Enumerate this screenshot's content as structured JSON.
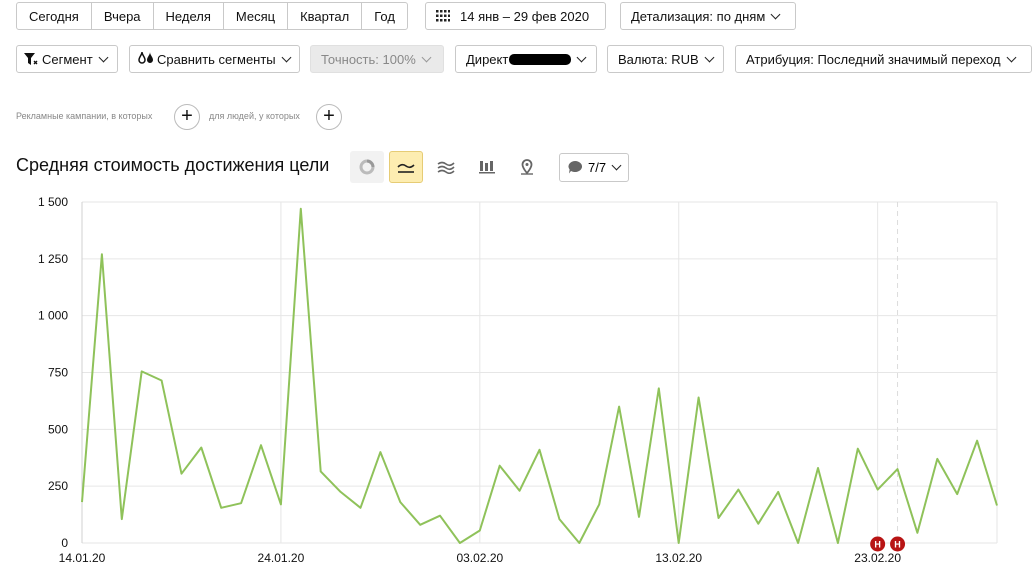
{
  "toolbar": {
    "periods": [
      "Сегодня",
      "Вчера",
      "Неделя",
      "Месяц",
      "Квартал",
      "Год"
    ],
    "date_range": "14 янв – 29 фев 2020",
    "detail": "Детализация: по дням"
  },
  "filters": {
    "segment": "Сегмент",
    "compare": "Сравнить сегменты",
    "accuracy": "Точность:  100%",
    "direct": "Директ",
    "currency": "Валюта: RUB",
    "attribution": "Атрибуция: Последний значимый переход"
  },
  "conditions": {
    "campaigns_hint": "Рекламные кампании, в которых",
    "people_hint": "для людей, у которых"
  },
  "report": {
    "title": "Средняя стоимость достижения цели",
    "annotations_count": "7/7",
    "marker_label": "Н"
  },
  "colors": {
    "line": "#8fc25a",
    "active_view": "#fdedb1",
    "marker": "#b81414",
    "holiday_label": "#b81414"
  },
  "chart_data": {
    "type": "line",
    "title": "Средняя стоимость достижения цели",
    "x_ticks": [
      "14.01.20",
      "24.01.20",
      "03.02.20",
      "13.02.20",
      "23.02.20"
    ],
    "y_ticks": [
      "0",
      "250",
      "500",
      "750",
      "1 000",
      "1 250",
      "1 500"
    ],
    "ylim": [
      0,
      1500
    ],
    "x_start": "2020-01-14",
    "x_end": "2020-02-29",
    "grid": true,
    "holiday_tick": "23.02.20",
    "marker_dates": [
      "2020-02-23",
      "2020-02-24"
    ],
    "series": [
      {
        "values": [
          180,
          1270,
          105,
          755,
          715,
          305,
          420,
          155,
          175,
          430,
          170,
          1470,
          315,
          225,
          155,
          400,
          180,
          80,
          120,
          0,
          55,
          340,
          230,
          410,
          105,
          0,
          170,
          600,
          115,
          680,
          0,
          640,
          110,
          235,
          85,
          225,
          0,
          330,
          0,
          415,
          235,
          325,
          45,
          370,
          215,
          450,
          165
        ]
      }
    ]
  }
}
